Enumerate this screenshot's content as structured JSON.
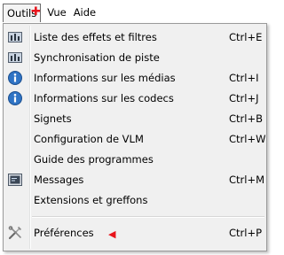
{
  "menubar": {
    "items": [
      {
        "label": "Outils"
      },
      {
        "label": "Vue"
      },
      {
        "label": "Aide"
      }
    ]
  },
  "menu": {
    "items": [
      {
        "label": "Liste des effets et filtres",
        "shortcut": "Ctrl+E",
        "icon": "equalizer-icon"
      },
      {
        "label": "Synchronisation de piste",
        "shortcut": "",
        "icon": "equalizer-icon"
      },
      {
        "label": "Informations sur les médias",
        "shortcut": "Ctrl+I",
        "icon": "info-icon"
      },
      {
        "label": "Informations sur les codecs",
        "shortcut": "Ctrl+J",
        "icon": "info-icon"
      },
      {
        "label": "Signets",
        "shortcut": "Ctrl+B",
        "icon": ""
      },
      {
        "label": "Configuration de VLM",
        "shortcut": "Ctrl+W",
        "icon": ""
      },
      {
        "label": "Guide des programmes",
        "shortcut": "",
        "icon": ""
      },
      {
        "label": "Messages",
        "shortcut": "Ctrl+M",
        "icon": "terminal-icon"
      },
      {
        "label": "Extensions et greffons",
        "shortcut": "",
        "icon": ""
      },
      {
        "label": "Préférences",
        "shortcut": "Ctrl+P",
        "icon": "tools-icon"
      }
    ]
  },
  "colors": {
    "marker": "#e8141b",
    "menu_background": "#f0f0f0",
    "info_icon": "#2f73c4"
  }
}
